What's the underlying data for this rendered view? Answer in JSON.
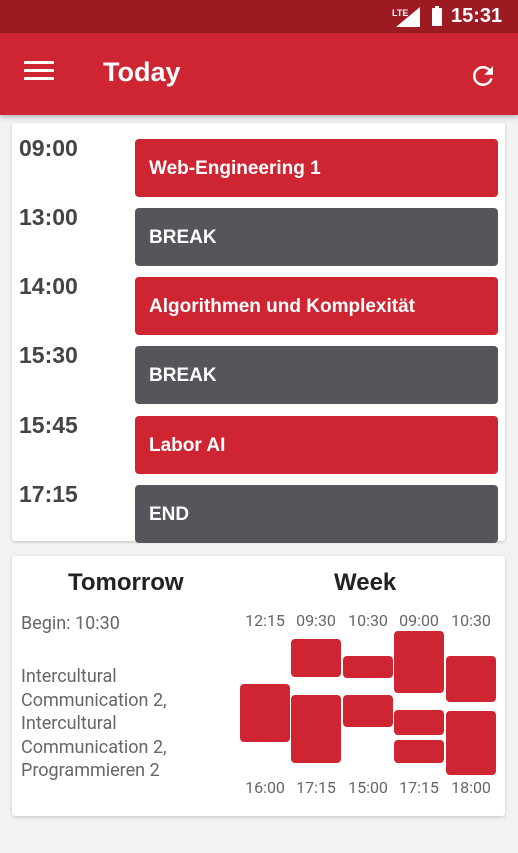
{
  "status_bar": {
    "network": "LTE",
    "time": "15:31"
  },
  "app_bar": {
    "title": "Today"
  },
  "today": [
    {
      "time": "09:00",
      "title": "Web-Engineering 1",
      "kind": "lecture"
    },
    {
      "time": "13:00",
      "title": "BREAK",
      "kind": "break"
    },
    {
      "time": "14:00",
      "title": "Algorithmen und Komplexität",
      "kind": "lecture"
    },
    {
      "time": "15:30",
      "title": "BREAK",
      "kind": "break"
    },
    {
      "time": "15:45",
      "title": "Labor AI",
      "kind": "lecture"
    },
    {
      "time": "17:15",
      "title": "END",
      "kind": "break"
    }
  ],
  "tomorrow": {
    "heading": "Tomorrow",
    "begin": "Begin: 10:30",
    "courses": [
      "Intercultural",
      "Communication 2,",
      "Intercultural",
      "Communication 2,",
      "Programmieren 2"
    ]
  },
  "week": {
    "heading": "Week",
    "start_times": [
      "12:15",
      "09:30",
      "10:30",
      "09:00",
      "10:30"
    ],
    "end_times": [
      "16:00",
      "17:15",
      "15:00",
      "17:15",
      "18:00"
    ]
  },
  "colors": {
    "lecture": "#cf2431",
    "break": "#55565b",
    "status_bar": "#9d1a22"
  }
}
